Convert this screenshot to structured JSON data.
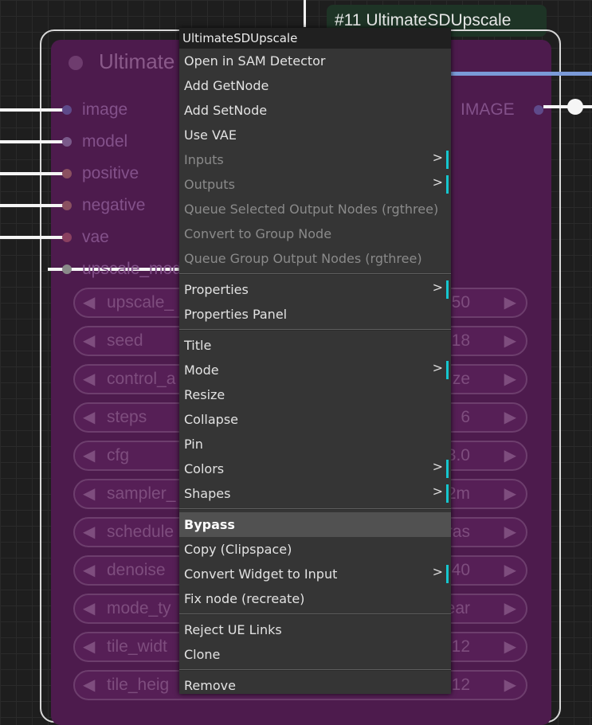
{
  "node": {
    "badge_title": "#11 UltimateSDUpscale",
    "title": "Ultimate",
    "inputs": [
      "image",
      "model",
      "positive",
      "negative",
      "vae",
      "upscale_model"
    ],
    "input_colors": [
      "#5e4a8a",
      "#7a5a8a",
      "#8a5060",
      "#8a5060",
      "#8a4060",
      "#8a8a8a"
    ],
    "output_label": "IMAGE",
    "widgets": [
      {
        "label": "upscale_",
        "value": "50"
      },
      {
        "label": "seed",
        "value": "18"
      },
      {
        "label": "control_a",
        "value": "ze"
      },
      {
        "label": "steps",
        "value": "6"
      },
      {
        "label": "cfg",
        "value": "3.0"
      },
      {
        "label": "sampler_",
        "value": "2m"
      },
      {
        "label": "schedule",
        "value": "ras"
      },
      {
        "label": "denoise",
        "value": "40"
      },
      {
        "label": "mode_ty",
        "value": "ear"
      },
      {
        "label": "tile_widt",
        "value": "12"
      },
      {
        "label": "tile_heig",
        "value": "12"
      }
    ]
  },
  "menu": {
    "title": "UltimateSDUpscale",
    "groups": [
      [
        {
          "label": "Open in SAM Detector"
        },
        {
          "label": "Add GetNode"
        },
        {
          "label": "Add SetNode"
        },
        {
          "label": "Use VAE"
        },
        {
          "label": "Inputs",
          "disabled": true,
          "submenu": true
        },
        {
          "label": "Outputs",
          "disabled": true,
          "submenu": true
        },
        {
          "label": "Queue Selected Output Nodes (rgthree)",
          "disabled": true
        },
        {
          "label": "Convert to Group Node",
          "disabled": true
        },
        {
          "label": "Queue Group Output Nodes (rgthree)",
          "disabled": true
        }
      ],
      [
        {
          "label": "Properties",
          "submenu": true
        },
        {
          "label": "Properties Panel"
        }
      ],
      [
        {
          "label": "Title"
        },
        {
          "label": "Mode",
          "submenu": true
        },
        {
          "label": "Resize"
        },
        {
          "label": "Collapse"
        },
        {
          "label": "Pin"
        },
        {
          "label": "Colors",
          "submenu": true
        },
        {
          "label": "Shapes",
          "submenu": true
        }
      ],
      [
        {
          "label": "Bypass",
          "hover": true
        },
        {
          "label": "Copy (Clipspace)"
        },
        {
          "label": "Convert Widget to Input",
          "submenu": true
        },
        {
          "label": "Fix node (recreate)"
        }
      ],
      [
        {
          "label": "Reject UE Links"
        },
        {
          "label": "Clone"
        }
      ],
      [
        {
          "label": "Remove"
        }
      ]
    ],
    "submenu_glyph": ">"
  }
}
